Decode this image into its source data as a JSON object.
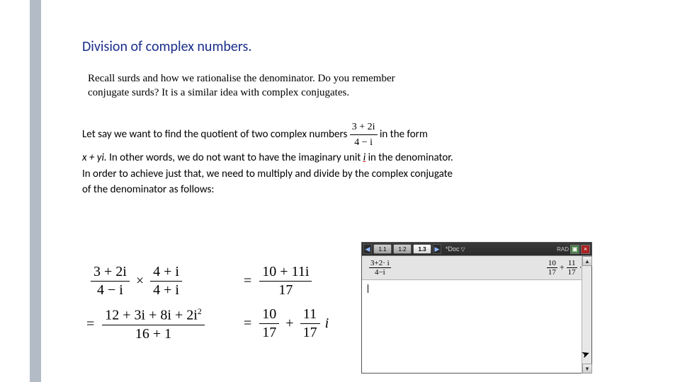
{
  "title": "Division of complex numbers.",
  "recall": "Recall surds and how we rationalise the denominator. Do you remember conjugate surds? It is a similar idea with complex conjugates.",
  "body": {
    "line1a": "Let say we want to find the quotient of two complex numbers ",
    "inline_frac_num": "3 + 2i",
    "inline_frac_den": "4 − i",
    "line1b": " in the form",
    "line2a": "x + yi. ",
    "line2b": "In other words, we do not want to have the imaginary unit ",
    "i_sym": "i",
    "line2c": " in the denominator.",
    "line3": "In order to achieve just that, we need to multiply and divide by the complex conjugate",
    "line4": "of the denominator as follows:"
  },
  "math": {
    "step1_left_num": "3 + 2i",
    "step1_left_den": "4 − i",
    "times": "×",
    "step1_right_num": "4 + i",
    "step1_right_den": "4 + i",
    "eq": "=",
    "step2_num": "10 + 11i",
    "step2_den": "17",
    "step3_num": "12 + 3i + 8i + 2i",
    "step3_sup": "2",
    "step3_den": "16 + 1",
    "step4_a_num": "10",
    "step4_a_den": "17",
    "plus": "+",
    "step4_b_num": "11",
    "step4_b_den": "17",
    "final_i": "i"
  },
  "calc": {
    "tabs": [
      "1.1",
      "1.2",
      "1.3"
    ],
    "active_tab": 2,
    "nav_prev": "◀",
    "nav_next": "▶",
    "doc_name": "*Doc",
    "doc_drop": "▽",
    "badge": "RAD",
    "btn_mid": "▣",
    "btn_close": "×",
    "row_input_num": "3+2· i",
    "row_input_den": "4−i",
    "row_out_a_num": "10",
    "row_out_a_den": "17",
    "row_out_plus": "+",
    "row_out_b_num": "11",
    "row_out_b_den": "17",
    "row_out_dot_i": "·i",
    "scroll_up": "▲",
    "scroll_down": "▼",
    "pointer": "➤"
  }
}
